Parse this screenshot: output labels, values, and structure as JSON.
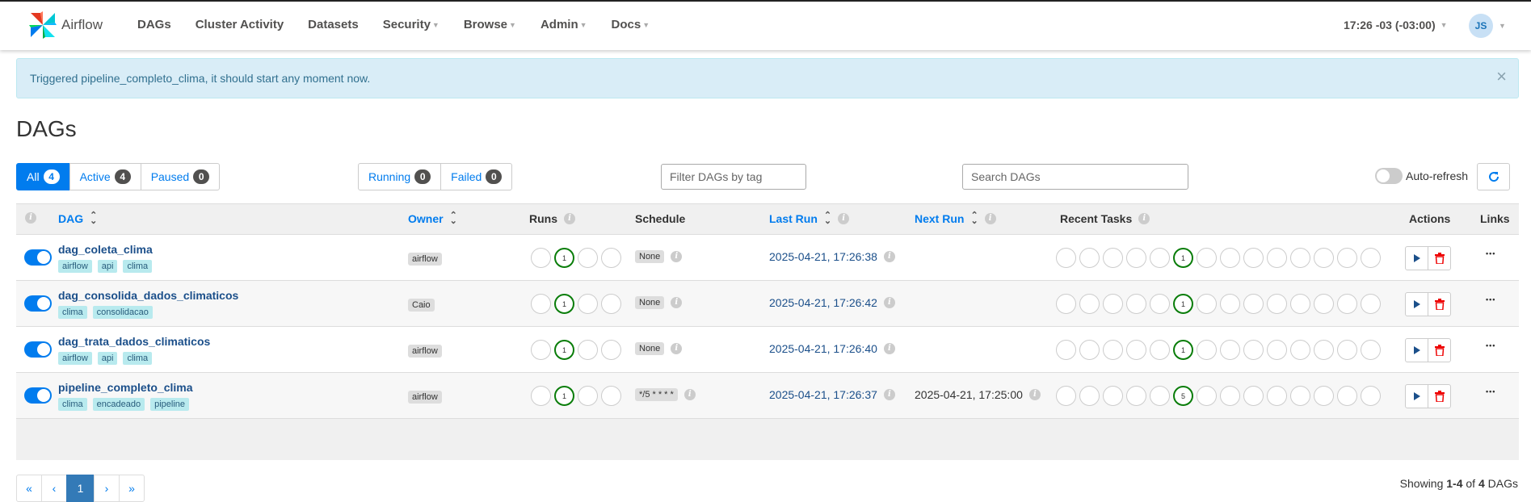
{
  "nav": {
    "brand": "Airflow",
    "items": [
      {
        "label": "DAGs",
        "caret": false
      },
      {
        "label": "Cluster Activity",
        "caret": false
      },
      {
        "label": "Datasets",
        "caret": false
      },
      {
        "label": "Security",
        "caret": true
      },
      {
        "label": "Browse",
        "caret": true
      },
      {
        "label": "Admin",
        "caret": true
      },
      {
        "label": "Docs",
        "caret": true
      }
    ],
    "time": "17:26 -03 (-03:00)",
    "user_initials": "JS"
  },
  "alert": {
    "message": "Triggered pipeline_completo_clima, it should start any moment now.",
    "close": "×"
  },
  "title": "DAGs",
  "filters": {
    "status": [
      {
        "label": "All",
        "count": "4",
        "active": true
      },
      {
        "label": "Active",
        "count": "4",
        "active": false
      },
      {
        "label": "Paused",
        "count": "0",
        "active": false
      }
    ],
    "runs": [
      {
        "label": "Running",
        "count": "0"
      },
      {
        "label": "Failed",
        "count": "0"
      }
    ],
    "tag_placeholder": "Filter DAGs by tag",
    "search_placeholder": "Search DAGs",
    "autorefresh_label": "Auto-refresh"
  },
  "table": {
    "headers": {
      "dag": "DAG",
      "owner": "Owner",
      "runs": "Runs",
      "schedule": "Schedule",
      "last_run": "Last Run",
      "next_run": "Next Run",
      "recent_tasks": "Recent Tasks",
      "actions": "Actions",
      "links": "Links"
    },
    "rows": [
      {
        "name": "dag_coleta_clima",
        "tags": [
          "airflow",
          "api",
          "clima"
        ],
        "owner": "airflow",
        "runs": [
          "",
          "1",
          "",
          ""
        ],
        "schedule": "None",
        "last_run": "2025-04-21, 17:26:38",
        "next_run": "",
        "recent_tasks_count": "1"
      },
      {
        "name": "dag_consolida_dados_climaticos",
        "tags": [
          "clima",
          "consolidacao"
        ],
        "owner": "Caio",
        "runs": [
          "",
          "1",
          "",
          ""
        ],
        "schedule": "None",
        "last_run": "2025-04-21, 17:26:42",
        "next_run": "",
        "recent_tasks_count": "1"
      },
      {
        "name": "dag_trata_dados_climaticos",
        "tags": [
          "airflow",
          "api",
          "clima"
        ],
        "owner": "airflow",
        "runs": [
          "",
          "1",
          "",
          ""
        ],
        "schedule": "None",
        "last_run": "2025-04-21, 17:26:40",
        "next_run": "",
        "recent_tasks_count": "1"
      },
      {
        "name": "pipeline_completo_clima",
        "tags": [
          "clima",
          "encadeado",
          "pipeline"
        ],
        "owner": "airflow",
        "runs": [
          "",
          "1",
          "",
          ""
        ],
        "schedule": "*/5 * * * *",
        "last_run": "2025-04-21, 17:26:37",
        "next_run": "2025-04-21, 17:25:00",
        "recent_tasks_count": "5"
      }
    ],
    "recent_tasks_success_index": 5,
    "recent_tasks_total": 14
  },
  "pagination": {
    "first": "«",
    "prev": "‹",
    "current": "1",
    "next": "›",
    "last": "»"
  },
  "showing": {
    "prefix": "Showing ",
    "range": "1-4",
    "of": " of ",
    "total": "4",
    "suffix": " DAGs"
  },
  "colors": {
    "accent": "#017cee",
    "success": "#0a7d0a",
    "tag_bg": "#b8eaee",
    "alert_bg": "#d9edf7"
  }
}
